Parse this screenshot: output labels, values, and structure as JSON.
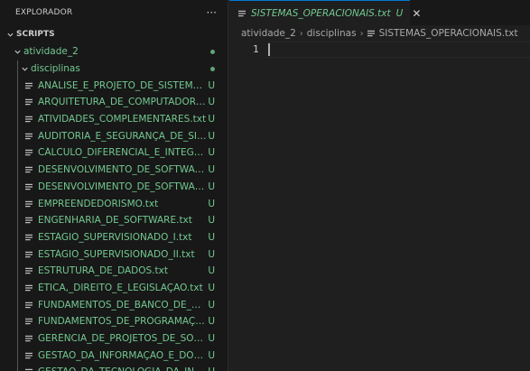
{
  "explorer": {
    "title": "EXPLORADOR",
    "more_actions": "···",
    "section": "SCRIPTS",
    "folders": [
      {
        "label": "atividade_2"
      },
      {
        "label": "disciplinas"
      }
    ],
    "files": [
      {
        "name": "ANÁLISE_E_PROJETO_DE_SISTEMAS.txt",
        "status": "U"
      },
      {
        "name": "ARQUITETURA_DE_COMPUTADORES....",
        "status": "U"
      },
      {
        "name": "ATIVIDADES_COMPLEMENTARES.txt",
        "status": "U"
      },
      {
        "name": "AUDITORIA_E_SEGURANÇA_DE_SISTE...",
        "status": "U"
      },
      {
        "name": "CÁLCULO_DIFERENCIAL_E_INTEGRAL...",
        "status": "U"
      },
      {
        "name": "DESENVOLVIMENTO_DE_SOFTWARE_...",
        "status": "U"
      },
      {
        "name": "DESENVOLVIMENTO_DE_SOFTWARE_...",
        "status": "U"
      },
      {
        "name": "EMPREENDEDORISMO.txt",
        "status": "U"
      },
      {
        "name": "ENGENHARIA_DE_SOFTWARE.txt",
        "status": "U"
      },
      {
        "name": "ESTÁGIO_SUPERVISIONADO_I.txt",
        "status": "U"
      },
      {
        "name": "ESTÁGIO_SUPERVISIONADO_II.txt",
        "status": "U"
      },
      {
        "name": "ESTRUTURA_DE_DADOS.txt",
        "status": "U"
      },
      {
        "name": "ÉTICA,_DIREITO_E_LEGISLAÇÃO.txt",
        "status": "U"
      },
      {
        "name": "FUNDAMENTOS_DE_BANCO_DE_DA...",
        "status": "U"
      },
      {
        "name": "FUNDAMENTOS_DE_PROGRAMAÇÃ...",
        "status": "U"
      },
      {
        "name": "GERÊNCIA_DE_PROJETOS_DE_SOFTW...",
        "status": "U"
      },
      {
        "name": "GESTÃO_DA_INFORMAÇÃO_E_DO_C...",
        "status": "U"
      },
      {
        "name": "GESTÃO_DA_TECNOLOGIA_DA_INFO...",
        "status": "U"
      }
    ]
  },
  "editor": {
    "tab": {
      "title": "SISTEMAS_OPERACIONAIS.txt",
      "status": "U",
      "close": "✕"
    },
    "breadcrumb": {
      "part1": "atividade_2",
      "part2": "disciplinas",
      "file": "SISTEMAS_OPERACIONAIS.txt",
      "separator": "›"
    },
    "line_number": "1"
  },
  "colors": {
    "untracked": "#73c991",
    "accent": "#0078d4"
  }
}
